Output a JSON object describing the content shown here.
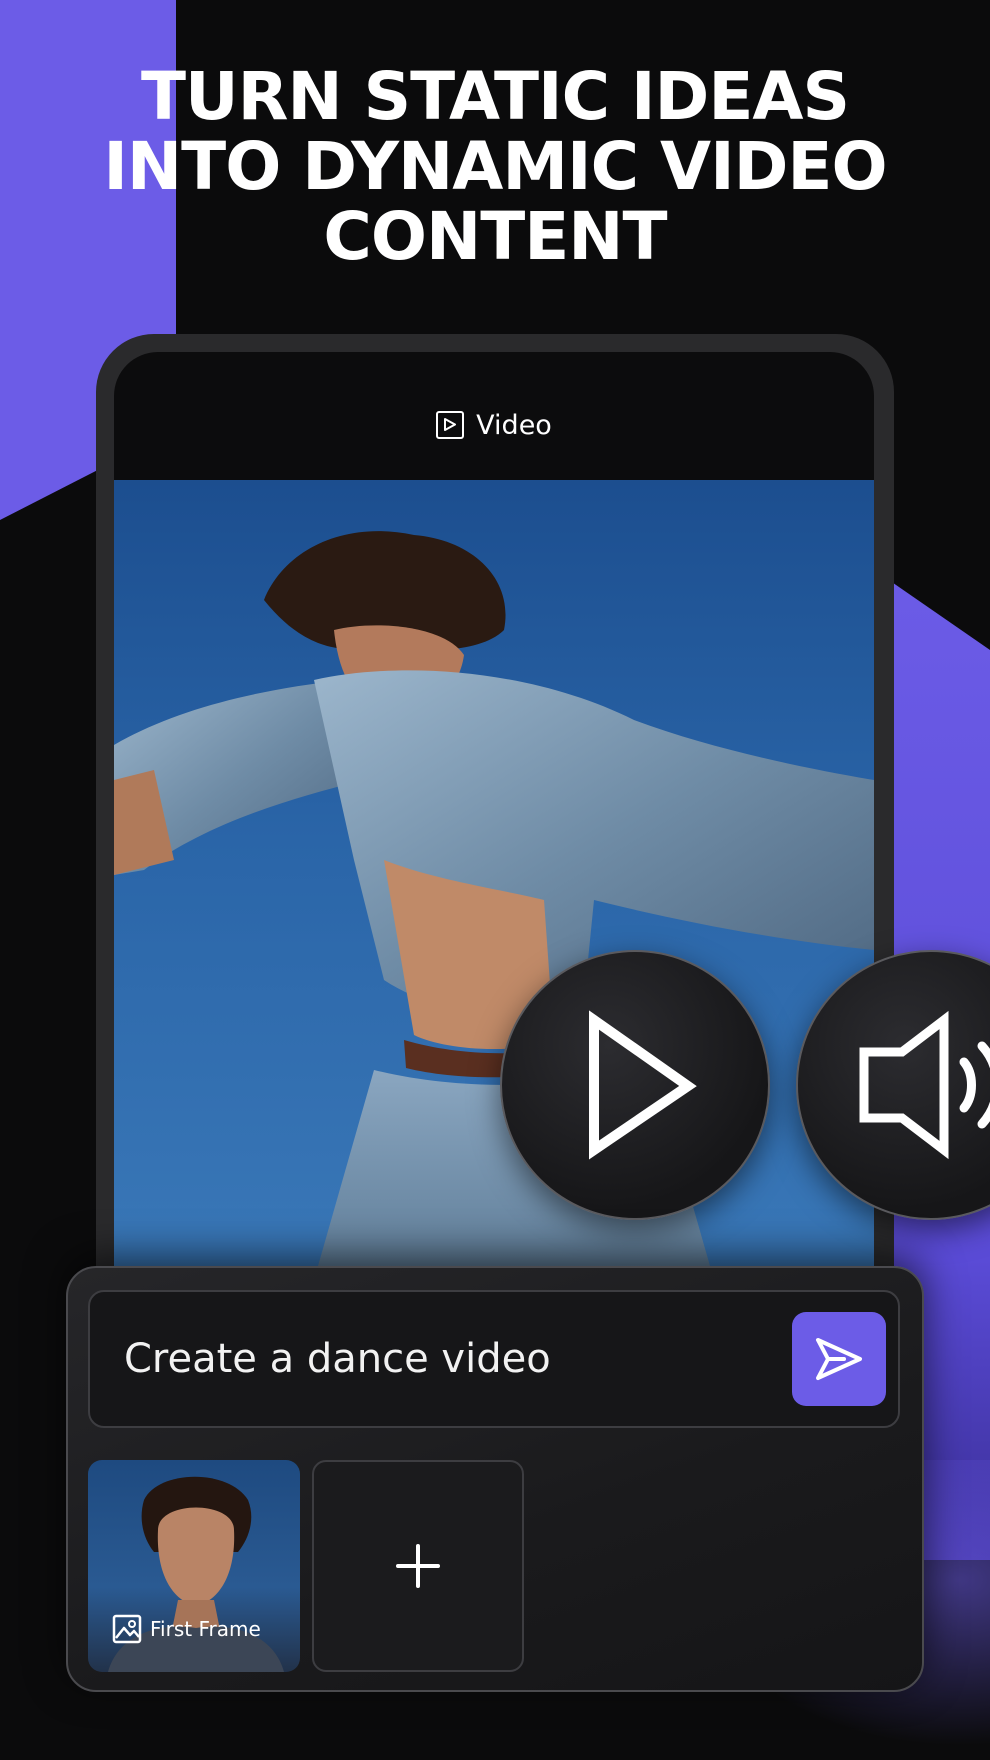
{
  "headline": {
    "line1": "TURN STATIC IDEAS",
    "line2": "INTO DYNAMIC VIDEO",
    "line3": "CONTENT"
  },
  "phone": {
    "header_label": "Video",
    "header_icon": "video-play-icon"
  },
  "controls": {
    "play_icon": "play-icon",
    "sound_icon": "speaker-icon"
  },
  "prompt": {
    "text": "Create a dance video",
    "send_icon": "send-icon"
  },
  "frames": {
    "first_frame_label": "First Frame",
    "first_frame_icon": "image-icon",
    "add_icon": "plus-icon"
  },
  "colors": {
    "accent": "#6c5ce7",
    "background": "#0b0b0c",
    "sky": "#2a65a8"
  }
}
